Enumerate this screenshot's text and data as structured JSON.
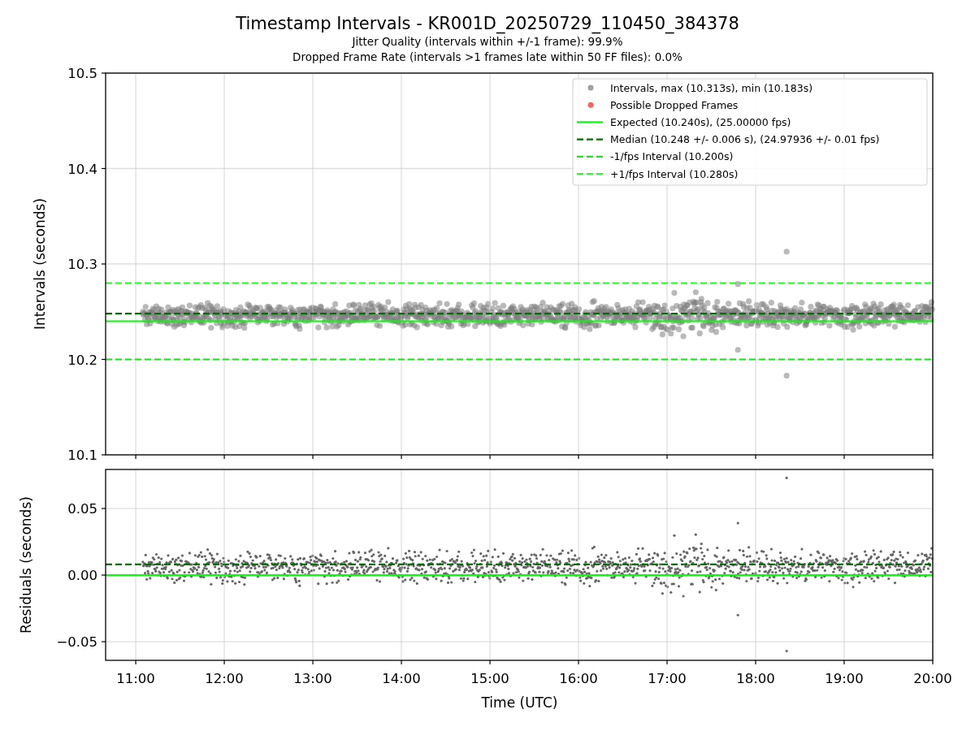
{
  "title": "Timestamp Intervals - KR001D_20250729_110450_384378",
  "subtitles": [
    "Jitter Quality (intervals within +/-1 frame): 99.9%",
    "Dropped Frame Rate (intervals >1 frames late within 50 FF files): 0.0%"
  ],
  "plots": [
    {
      "chart_data": {
        "type": "line",
        "ylabel": "Intervals (seconds)",
        "grid": true,
        "legend": "upper right",
        "xlim": [
          10.66,
          20.0
        ],
        "ylim": [
          10.1,
          10.5
        ],
        "yticks": [
          {
            "value": 10.1,
            "label": "10.1"
          },
          {
            "value": 10.2,
            "label": "10.2"
          },
          {
            "value": 10.3,
            "label": "10.3"
          },
          {
            "value": 10.4,
            "label": "10.4"
          },
          {
            "value": 10.5,
            "label": "10.5"
          }
        ],
        "ref_lines": [
          {
            "axis": "y",
            "value": 10.24,
            "label": "Expected (10.240s), (25.00000 fps)",
            "color": "#00ff00",
            "line_style": "solid"
          },
          {
            "axis": "y",
            "value": 10.248,
            "label": "Median (10.248 +/- 0.006 s), (24.97936 +/- 0.01 fps)",
            "color": "#007000",
            "line_style": "dashed"
          },
          {
            "axis": "y",
            "value": 10.2,
            "label": "-1/fps Interval (10.200s)",
            "color": "#20e020",
            "line_style": "dashed"
          },
          {
            "axis": "y",
            "value": 10.28,
            "label": "+1/fps Interval (10.280s)",
            "color": "#20ff20",
            "line_style": "dashed"
          }
        ]
      },
      "legend_markers": [
        {
          "label": "Intervals, max (10.313s), min (10.183s)",
          "color": "#a0a0a0"
        },
        {
          "label": "Possible Dropped Frames",
          "color": "#ff6060"
        }
      ]
    },
    {
      "chart_data": {
        "type": "line",
        "xlabel": "Time (UTC)",
        "ylabel": "Residuals (seconds)",
        "grid": true,
        "xlim": [
          10.66,
          20.0
        ],
        "ylim": [
          -0.064,
          0.0793
        ],
        "xticks": [
          {
            "value": 11,
            "label": "11:00"
          },
          {
            "value": 12,
            "label": "12:00"
          },
          {
            "value": 13,
            "label": "13:00"
          },
          {
            "value": 14,
            "label": "14:00"
          },
          {
            "value": 15,
            "label": "15:00"
          },
          {
            "value": 16,
            "label": "16:00"
          },
          {
            "value": 17,
            "label": "17:00"
          },
          {
            "value": 18,
            "label": "18:00"
          },
          {
            "value": 19,
            "label": "19:00"
          },
          {
            "value": 20,
            "label": "20:00"
          }
        ],
        "yticks": [
          {
            "value": -0.05,
            "label": "−0.05"
          },
          {
            "value": 0,
            "label": "0.00"
          },
          {
            "value": 0.05,
            "label": "0.05"
          }
        ],
        "ref_lines": [
          {
            "axis": "y",
            "value": 0,
            "color": "#00ff00",
            "line_style": "solid"
          },
          {
            "axis": "y",
            "value": 0.008,
            "color": "#007000",
            "line_style": "dashed"
          }
        ]
      }
    }
  ]
}
